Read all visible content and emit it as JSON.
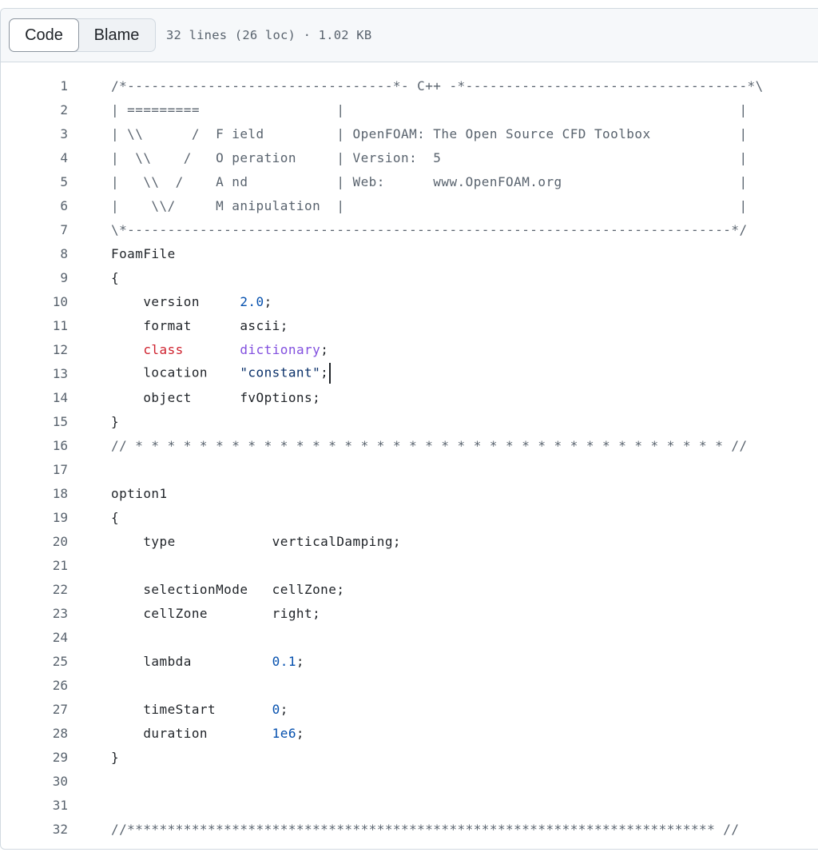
{
  "toolbar": {
    "code_label": "Code",
    "blame_label": "Blame",
    "file_info": "32 lines (26 loc) · 1.02 KB"
  },
  "lines": [
    {
      "n": "1",
      "tokens": [
        {
          "t": "/*---------------------------------*- C++ -*-----------------------------------*\\",
          "c": "comment"
        }
      ]
    },
    {
      "n": "2",
      "tokens": [
        {
          "t": "| =========                 |                                                 |",
          "c": "comment"
        }
      ]
    },
    {
      "n": "3",
      "tokens": [
        {
          "t": "| \\\\      /  F ield         | OpenFOAM: The Open Source CFD Toolbox           |",
          "c": "comment"
        }
      ]
    },
    {
      "n": "4",
      "tokens": [
        {
          "t": "|  \\\\    /   O peration     | Version:  5                                     |",
          "c": "comment"
        }
      ]
    },
    {
      "n": "5",
      "tokens": [
        {
          "t": "|   \\\\  /    A nd           | Web:      www.OpenFOAM.org                      |",
          "c": "comment"
        }
      ]
    },
    {
      "n": "6",
      "tokens": [
        {
          "t": "|    \\\\/     M anipulation  |                                                 |",
          "c": "comment"
        }
      ]
    },
    {
      "n": "7",
      "tokens": [
        {
          "t": "\\*---------------------------------------------------------------------------*/",
          "c": "comment"
        }
      ]
    },
    {
      "n": "8",
      "tokens": [
        {
          "t": "FoamFile",
          "c": ""
        }
      ]
    },
    {
      "n": "9",
      "tokens": [
        {
          "t": "{",
          "c": ""
        }
      ]
    },
    {
      "n": "10",
      "tokens": [
        {
          "t": "    version     ",
          "c": ""
        },
        {
          "t": "2.0",
          "c": "num"
        },
        {
          "t": ";",
          "c": ""
        }
      ]
    },
    {
      "n": "11",
      "tokens": [
        {
          "t": "    format      ascii;",
          "c": ""
        }
      ]
    },
    {
      "n": "12",
      "tokens": [
        {
          "t": "    ",
          "c": ""
        },
        {
          "t": "class",
          "c": "kw"
        },
        {
          "t": "       ",
          "c": ""
        },
        {
          "t": "dictionary",
          "c": "type"
        },
        {
          "t": ";",
          "c": ""
        }
      ]
    },
    {
      "n": "13",
      "tokens": [
        {
          "t": "    location    ",
          "c": ""
        },
        {
          "t": "\"constant\"",
          "c": "str"
        },
        {
          "t": ";",
          "c": ""
        }
      ],
      "caret": true
    },
    {
      "n": "14",
      "tokens": [
        {
          "t": "    object      fvOptions;",
          "c": ""
        }
      ]
    },
    {
      "n": "15",
      "tokens": [
        {
          "t": "}",
          "c": ""
        }
      ]
    },
    {
      "n": "16",
      "tokens": [
        {
          "t": "// * * * * * * * * * * * * * * * * * * * * * * * * * * * * * * * * * * * * * //",
          "c": "comment"
        }
      ]
    },
    {
      "n": "17",
      "tokens": []
    },
    {
      "n": "18",
      "tokens": [
        {
          "t": "option1",
          "c": ""
        }
      ]
    },
    {
      "n": "19",
      "tokens": [
        {
          "t": "{",
          "c": ""
        }
      ]
    },
    {
      "n": "20",
      "tokens": [
        {
          "t": "    type            verticalDamping;",
          "c": ""
        }
      ]
    },
    {
      "n": "21",
      "tokens": []
    },
    {
      "n": "22",
      "tokens": [
        {
          "t": "    selectionMode   cellZone;",
          "c": ""
        }
      ]
    },
    {
      "n": "23",
      "tokens": [
        {
          "t": "    cellZone        right;",
          "c": ""
        }
      ]
    },
    {
      "n": "24",
      "tokens": []
    },
    {
      "n": "25",
      "tokens": [
        {
          "t": "    lambda          ",
          "c": ""
        },
        {
          "t": "0.1",
          "c": "num"
        },
        {
          "t": ";",
          "c": ""
        }
      ]
    },
    {
      "n": "26",
      "tokens": []
    },
    {
      "n": "27",
      "tokens": [
        {
          "t": "    timeStart       ",
          "c": ""
        },
        {
          "t": "0",
          "c": "num"
        },
        {
          "t": ";",
          "c": ""
        }
      ]
    },
    {
      "n": "28",
      "tokens": [
        {
          "t": "    duration        ",
          "c": ""
        },
        {
          "t": "1e6",
          "c": "num"
        },
        {
          "t": ";",
          "c": ""
        }
      ]
    },
    {
      "n": "29",
      "tokens": [
        {
          "t": "}",
          "c": ""
        }
      ]
    },
    {
      "n": "30",
      "tokens": []
    },
    {
      "n": "31",
      "tokens": []
    },
    {
      "n": "32",
      "tokens": [
        {
          "t": "//************************************************************************* //",
          "c": "comment"
        }
      ]
    }
  ],
  "colors": {
    "comment": "#59636e",
    "number": "#0550ae",
    "string": "#0a3069",
    "keyword": "#cf222e",
    "type": "#8250df",
    "border": "#d1d9e0"
  }
}
